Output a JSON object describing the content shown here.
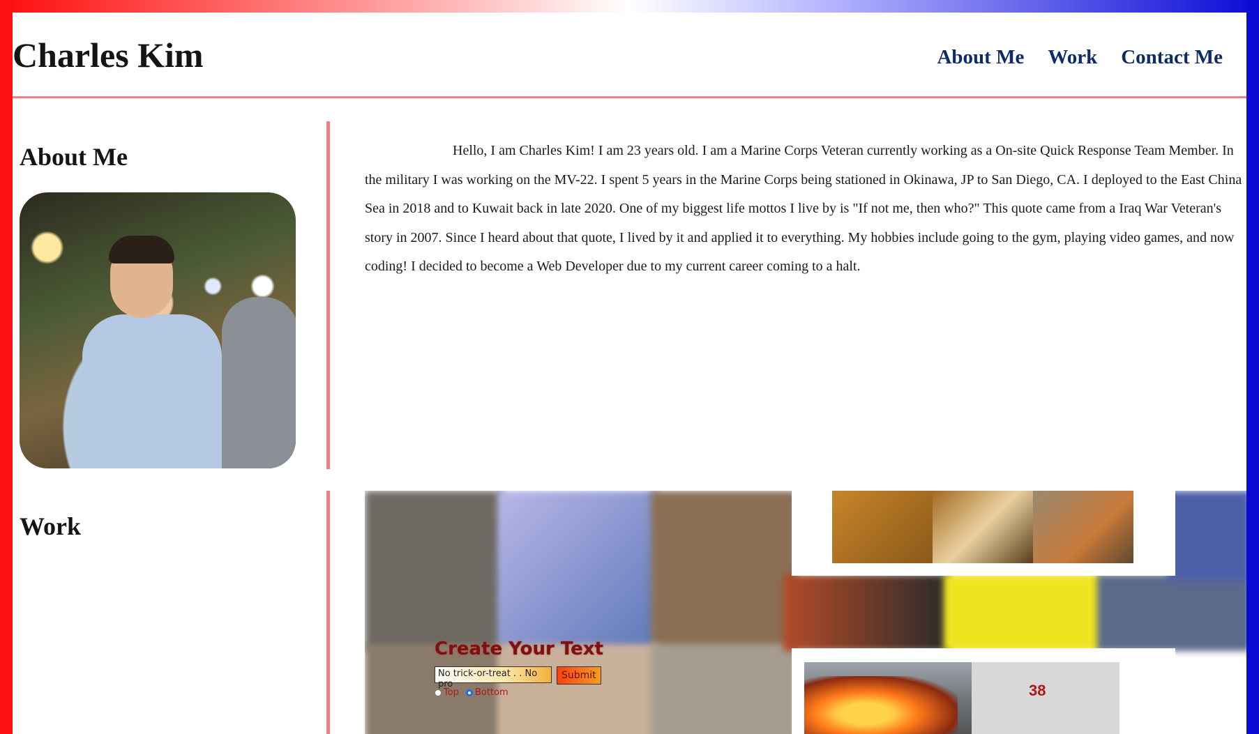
{
  "header": {
    "site_title": "Charles Kim",
    "nav": [
      "About Me",
      "Work",
      "Contact Me"
    ]
  },
  "about": {
    "heading": "About Me",
    "photo_alt": "Charles Kim",
    "bio": "Hello, I am Charles Kim! I am 23 years old. I am a Marine Corps Veteran currently working as a On-site Quick Response Team Member. In the military I was working on the MV-22. I spent 5 years in the Marine Corps being stationed in Okinawa, JP to San Diego, CA. I deployed to the East China Sea in 2018 and to Kuwait back in late 2020. One of my biggest life mottos I live by is \"If not me, then who?\" This quote came from a Iraq War Veteran's story in 2007. Since I heard about that quote, I lived by it and applied it to everything. My hobbies include going to the gym, playing video games, and now coding! I decided to become a Web Developer due to my current career coming to a halt."
  },
  "work": {
    "heading": "Work",
    "meme_generator": {
      "title": "Create Your Text",
      "input_value": "No trick-or-treat . . No pro",
      "submit_label": "Submit",
      "radio_top_label": "Top",
      "radio_bottom_label": "Bottom",
      "selected": "Bottom"
    },
    "fire_truck_number": "38"
  },
  "colors": {
    "frame_left": "#ff1010",
    "frame_right": "#0b0bd6",
    "accent_line": "#f07f7f",
    "nav_link": "#0d2a6b"
  }
}
